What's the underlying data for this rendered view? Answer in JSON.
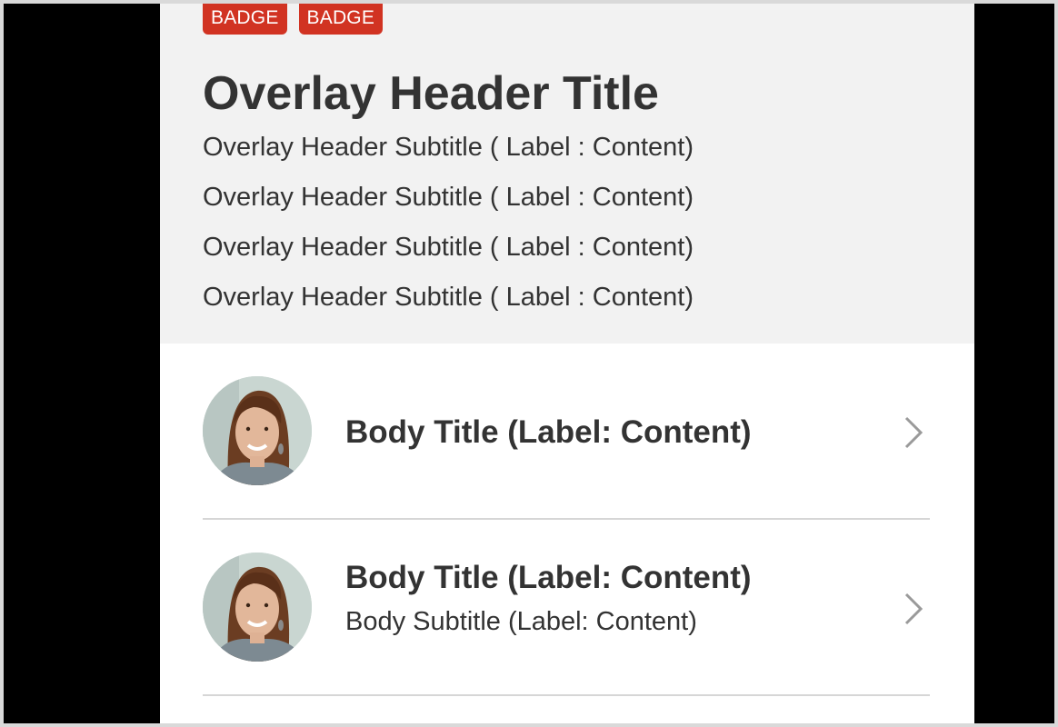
{
  "header": {
    "badges": [
      "BADGE",
      "BADGE"
    ],
    "title": "Overlay Header Title",
    "subtitles": [
      "Overlay Header Subtitle ( Label : Content)",
      "Overlay Header Subtitle ( Label : Content)",
      "Overlay Header Subtitle ( Label : Content)",
      "Overlay Header Subtitle ( Label : Content)"
    ]
  },
  "list": [
    {
      "title": "Body Title (Label: Content)",
      "icon": "chevron-right-icon"
    },
    {
      "title": "Body Title (Label: Content)",
      "subtitle": "Body Subtitle (Label: Content)",
      "icon": "chevron-right-icon"
    }
  ],
  "colors": {
    "badge": "#d13322",
    "header_bg": "#f2f2f2",
    "text": "#333333",
    "divider": "#d6d6d6",
    "chevron": "#9a9a9a",
    "backdrop": "#000000"
  }
}
